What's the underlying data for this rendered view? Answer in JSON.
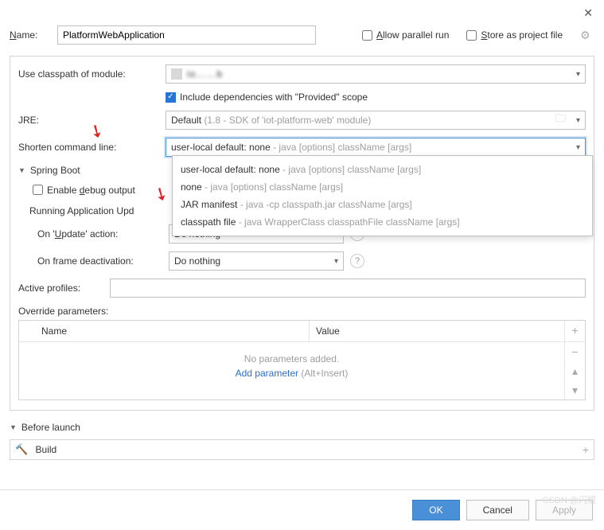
{
  "close_icon": "✕",
  "name_label": "Name:",
  "name_value": "PlatformWebApplication",
  "allow_parallel": "Allow parallel run",
  "store_project": "Store as project file",
  "classpath_label": "Use classpath of module:",
  "classpath_value_blur": "io……b",
  "include_provided": "Include dependencies with \"Provided\" scope",
  "jre_label": "JRE:",
  "jre_prefix": "Default",
  "jre_detail": " (1.8 - SDK of 'iot-platform-web' module)",
  "shorten_label": "Shorten command line:",
  "shorten_selected_bold": "user-local default: none",
  "shorten_selected_gray": " - java [options] className [args]",
  "dropdown": [
    {
      "bold": "user-local default: none",
      "gray": " - java [options] className [args]"
    },
    {
      "bold": "none",
      "gray": " - java [options] className [args]"
    },
    {
      "bold": "JAR manifest",
      "gray": " - java -cp classpath.jar className [args]"
    },
    {
      "bold": "classpath file",
      "gray": " - java WrapperClass classpathFile className [args]"
    }
  ],
  "spring_boot": "Spring Boot",
  "enable_debug": "Enable debug output",
  "running_update": "Running Application Upd",
  "on_update_label": "On 'Update' action:",
  "on_frame_label": "On frame deactivation:",
  "do_nothing": "Do nothing",
  "active_profiles": "Active profiles:",
  "override_params": "Override parameters:",
  "col_name": "Name",
  "col_value": "Value",
  "no_params": "No parameters added.",
  "add_param": "Add parameter",
  "add_param_hint": " (Alt+Insert)",
  "before_launch": "Before launch",
  "build": "Build",
  "btn_ok": "OK",
  "btn_cancel": "Cancel",
  "btn_apply": "Apply",
  "watermark": "CSDN @闪耀"
}
